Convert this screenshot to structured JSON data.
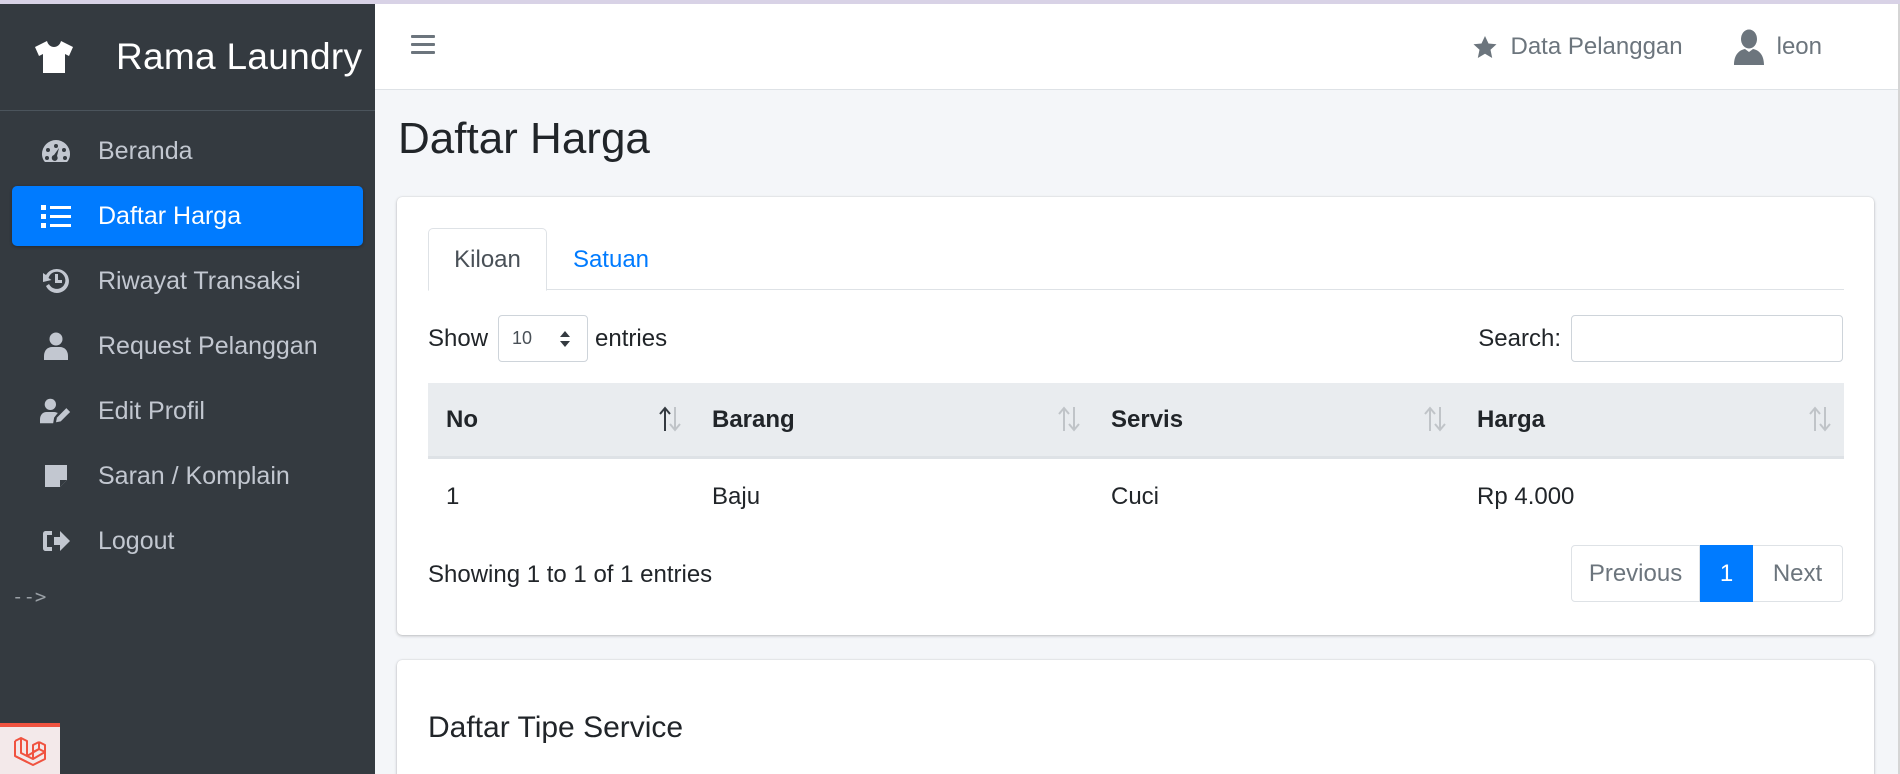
{
  "brand": {
    "name": "Rama Laundry",
    "icon": "tshirt-icon"
  },
  "sidebar": {
    "items": [
      {
        "label": "Beranda",
        "icon": "tachometer-icon",
        "active": false
      },
      {
        "label": "Daftar Harga",
        "icon": "list-icon",
        "active": true
      },
      {
        "label": "Riwayat Transaksi",
        "icon": "history-icon",
        "active": false
      },
      {
        "label": "Request Pelanggan",
        "icon": "user-icon",
        "active": false
      },
      {
        "label": "Edit Profil",
        "icon": "user-edit-icon",
        "active": false
      },
      {
        "label": "Saran / Komplain",
        "icon": "sticky-note-icon",
        "active": false
      },
      {
        "label": "Logout",
        "icon": "sign-out-icon",
        "active": false
      }
    ],
    "stray_text": "-->"
  },
  "topbar": {
    "data_pelanggan": "Data Pelanggan",
    "username": "leon"
  },
  "page": {
    "title": "Daftar Harga"
  },
  "tabs": [
    {
      "label": "Kiloan",
      "active": true
    },
    {
      "label": "Satuan",
      "active": false
    }
  ],
  "datatable": {
    "show_label": "Show",
    "entries_label": "entries",
    "page_length": "10",
    "search_label": "Search:",
    "search_value": "",
    "columns": [
      "No",
      "Barang",
      "Servis",
      "Harga"
    ],
    "rows": [
      [
        "1",
        "Baju",
        "Cuci",
        "Rp 4.000"
      ]
    ],
    "info": "Showing 1 to 1 of 1 entries",
    "pagination": {
      "previous": "Previous",
      "current": "1",
      "next": "Next"
    }
  },
  "service_card": {
    "title": "Daftar Tipe Service"
  },
  "colors": {
    "sidebar_bg": "#343a40",
    "accent": "#007bff",
    "content_bg": "#f4f6f9"
  }
}
